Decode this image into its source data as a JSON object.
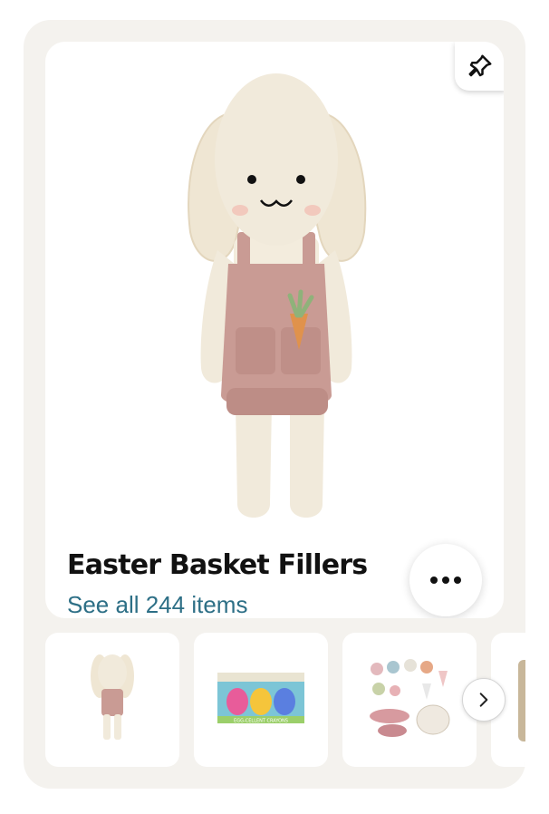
{
  "collection": {
    "title": "Easter Basket Fillers",
    "see_all_label": "See all 244 items"
  },
  "hero_image_alt": "knit bunny doll in pink overalls with carrot",
  "thumbnails": [
    {
      "name": "bunny-doll",
      "alt": "knit bunny doll"
    },
    {
      "name": "egg-crayons",
      "alt": "egg crayons box",
      "box_label": "EGG-CELLENT CRAYONS"
    },
    {
      "name": "ice-cream-set",
      "alt": "silicone ice cream sand toy set"
    },
    {
      "name": "partial-item",
      "alt": "partially visible item"
    }
  ],
  "icons": {
    "pin": "pin-icon",
    "more": "more-options-icon",
    "next": "chevron-right-icon"
  },
  "colors": {
    "page_bg": "#ffffff",
    "outer_card_bg": "#f4f2ee",
    "link": "#2d6f86",
    "title": "#111111"
  }
}
